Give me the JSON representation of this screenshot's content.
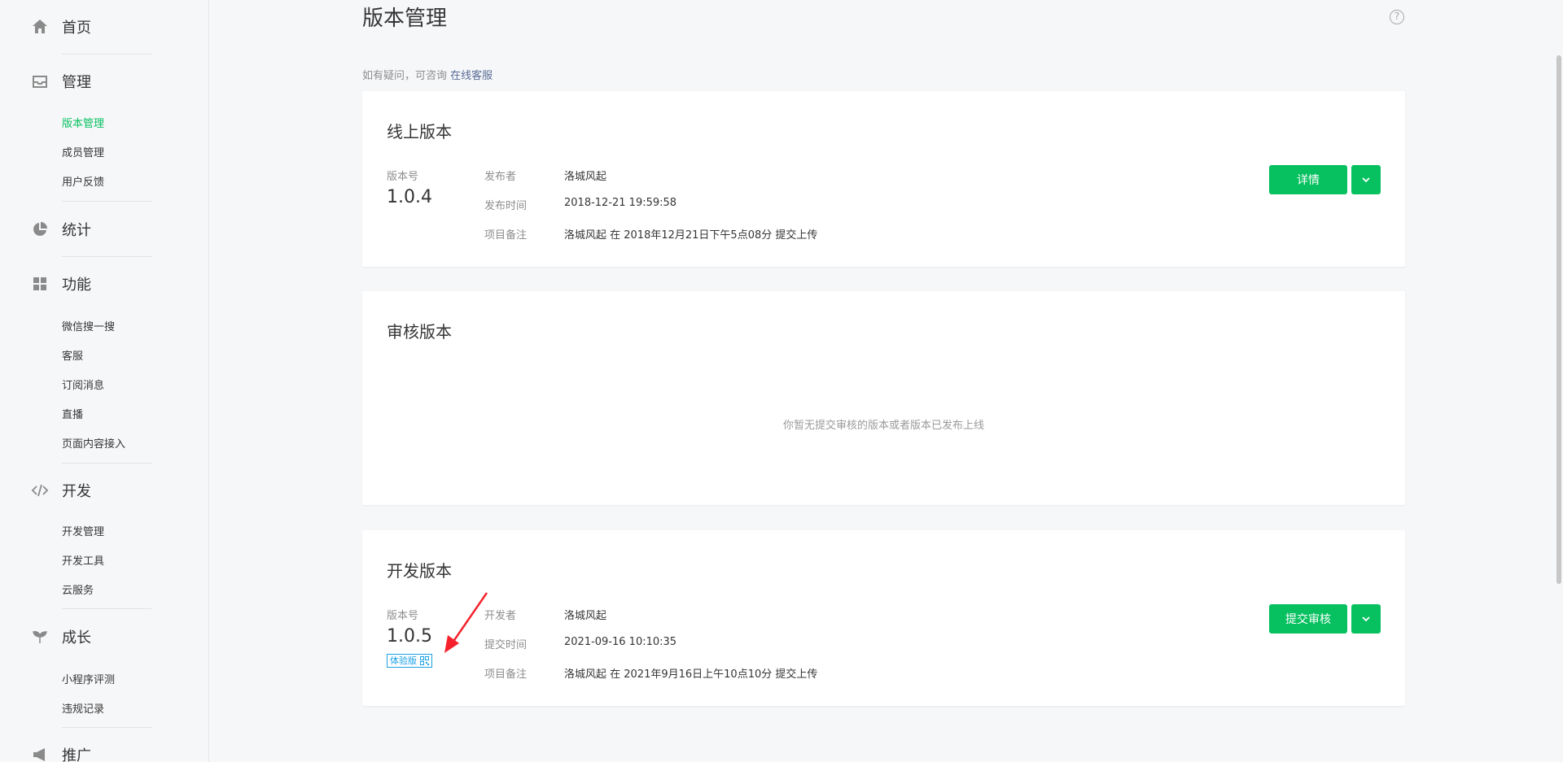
{
  "sidebar": {
    "home": "首页",
    "manage": {
      "label": "管理",
      "items": [
        "版本管理",
        "成员管理",
        "用户反馈"
      ]
    },
    "stats": {
      "label": "统计"
    },
    "features": {
      "label": "功能",
      "items": [
        "微信搜一搜",
        "客服",
        "订阅消息",
        "直播",
        "页面内容接入"
      ]
    },
    "dev": {
      "label": "开发",
      "items": [
        "开发管理",
        "开发工具",
        "云服务"
      ]
    },
    "growth": {
      "label": "成长",
      "items": [
        "小程序评测",
        "违规记录"
      ]
    },
    "promo": {
      "label": "推广"
    }
  },
  "header": {
    "title": "版本管理",
    "tip_text": "如有疑问，可咨询",
    "tip_link": "在线客服"
  },
  "online": {
    "title": "线上版本",
    "version_label": "版本号",
    "version": "1.0.4",
    "publisher_label": "发布者",
    "publisher": "洛城风起",
    "time_label": "发布时间",
    "time": "2018-12-21 19:59:58",
    "note_label": "项目备注",
    "note": "洛城风起 在 2018年12月21日下午5点08分 提交上传",
    "button": "详情"
  },
  "review": {
    "title": "审核版本",
    "empty": "你暂无提交审核的版本或者版本已发布上线"
  },
  "devver": {
    "title": "开发版本",
    "version_label": "版本号",
    "version": "1.0.5",
    "tag": "体验版",
    "dev_label": "开发者",
    "developer": "洛城风起",
    "time_label": "提交时间",
    "time": "2021-09-16 10:10:35",
    "note_label": "项目备注",
    "note": "洛城风起 在 2021年9月16日上午10点10分 提交上传",
    "button": "提交审核"
  },
  "colors": {
    "brand": "#07c160",
    "link": "#576b95",
    "tag": "#1aa1e5",
    "arrow": "#f5222d"
  }
}
